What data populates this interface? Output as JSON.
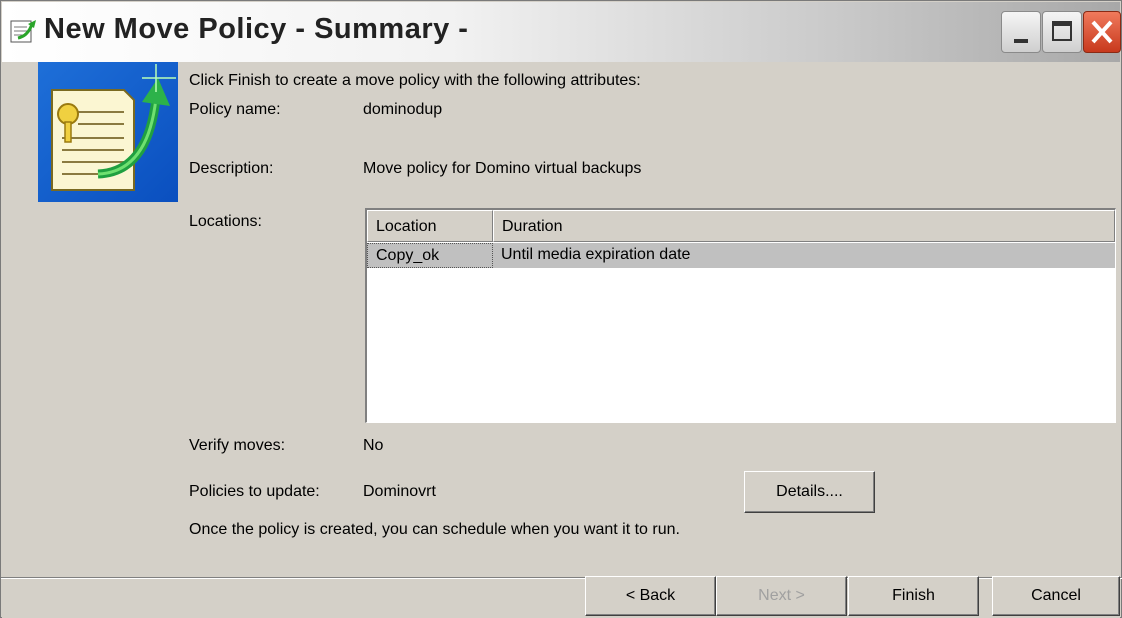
{
  "window": {
    "title": "New Move Policy - Summary -"
  },
  "summary": {
    "intro": "Click Finish to create a move policy with the following attributes:",
    "policy_name_label": "Policy name:",
    "policy_name_value": "dominodup",
    "description_label": "Description:",
    "description_value": "Move policy for Domino virtual backups",
    "locations_label": "Locations:",
    "verify_label": "Verify moves:",
    "verify_value": "No",
    "policies_update_label": "Policies to update:",
    "policies_update_value": "Dominovrt",
    "details_button": "Details....",
    "footer_note": "Once the policy is created, you can schedule when you want it to run."
  },
  "locations_table": {
    "columns": [
      "Location",
      "Duration"
    ],
    "rows": [
      {
        "location": "Copy_ok",
        "duration": "Until media expiration date"
      }
    ]
  },
  "buttons": {
    "back": "< Back",
    "next": "Next >",
    "finish": "Finish",
    "cancel": "Cancel"
  },
  "icons": {
    "title": "wizard-app-icon",
    "wizard": "document-move-arrow-icon",
    "minimize": "minimize-icon",
    "maximize": "maximize-icon",
    "close": "close-icon"
  }
}
